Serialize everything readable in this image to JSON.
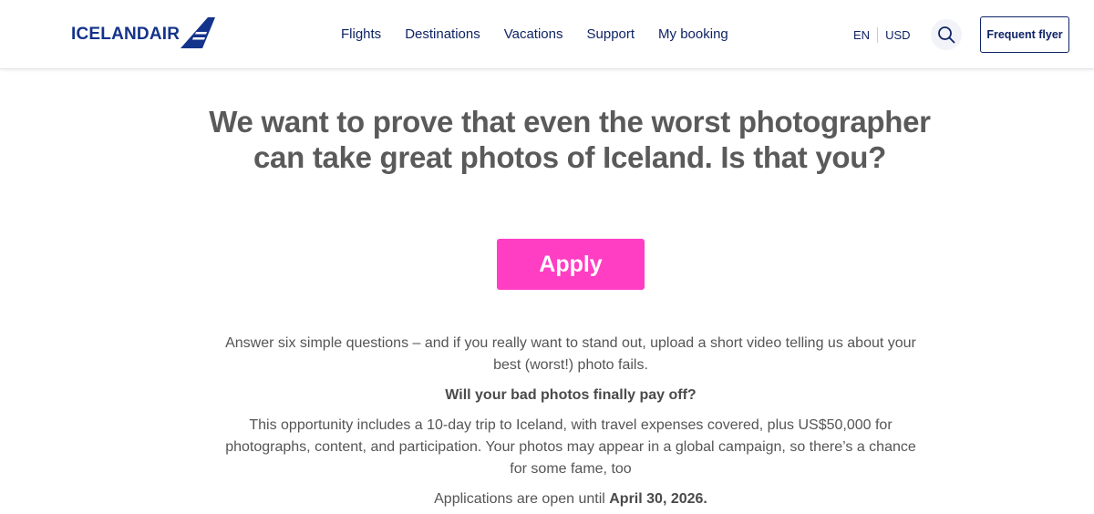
{
  "header": {
    "logo_text": "ICELANDAIR",
    "nav": [
      {
        "label": "Flights"
      },
      {
        "label": "Destinations"
      },
      {
        "label": "Vacations"
      },
      {
        "label": "Support"
      },
      {
        "label": "My booking"
      }
    ],
    "language": "EN",
    "currency": "USD",
    "search_icon": "search-icon",
    "frequent_flyer_label": "Frequent flyer"
  },
  "main": {
    "headline_line1": "We want to prove that even the worst photographer",
    "headline_line2": "can take great photos of Iceland. Is that you?",
    "apply_label": "Apply",
    "intro_line1": "Answer six simple questions – and if you really want to stand out, upload a short video telling us about your",
    "intro_line2": "best (worst!) photo fails.",
    "subheading": "Will your bad photos finally pay off?",
    "details_line1": "This opportunity includes a 10-day trip to Iceland, with travel expenses covered, plus US$50,000 for",
    "details_line2": "photographs, content, and participation. Your photos may appear in a global campaign, so there’s a chance",
    "details_line3": "for some fame, too",
    "deadline_prefix": "Applications are open until ",
    "deadline_date": "April 30, 2026."
  },
  "colors": {
    "brand_navy": "#14338a",
    "nav_text": "#0f2466",
    "apply_pink": "#ff3ec3",
    "body_text": "#555555"
  }
}
